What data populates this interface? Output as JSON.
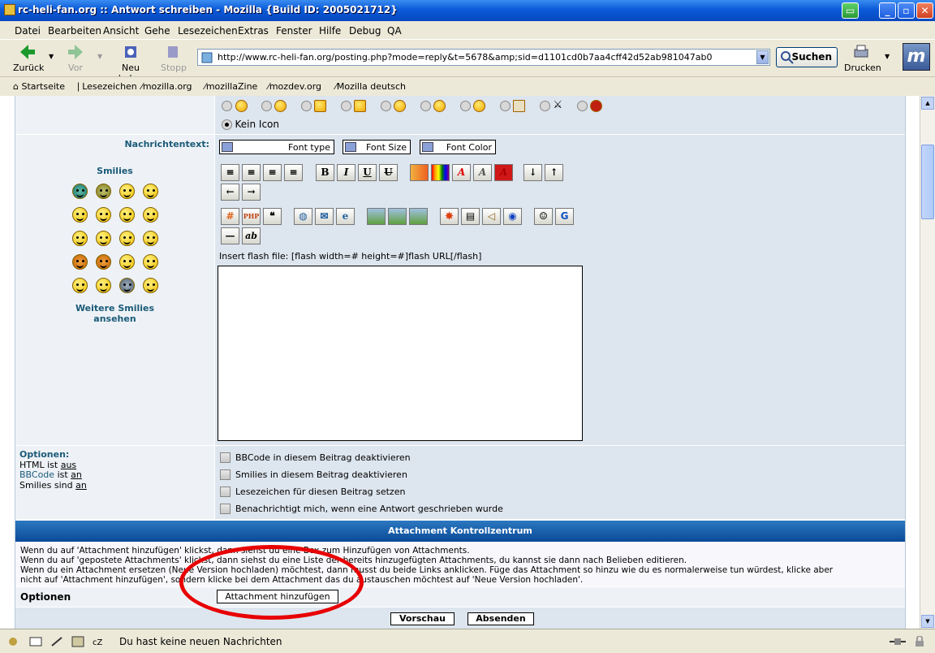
{
  "window": {
    "title": "rc-heli-fan.org :: Antwort schreiben - Mozilla {Build ID: 2005021712}"
  },
  "menu": [
    "Datei",
    "Bearbeiten",
    "Ansicht",
    "Gehe",
    "Lesezeichen",
    "Extras",
    "Fenster",
    "Hilfe",
    "Debug",
    "QA"
  ],
  "nav": {
    "back": "Zurück",
    "forward": "Vor",
    "reload": "Neu laden",
    "stop": "Stopp",
    "url": "http://www.rc-heli-fan.org/posting.php?mode=reply&t=5678&amp;sid=d1101cd0b7aa4cff42d52ab981047ab0",
    "search": "Suchen",
    "print": "Drucken"
  },
  "bookmarks": [
    "Startseite",
    "Lesezeichen",
    "mozilla.org",
    "mozillaZine",
    "mozdev.org",
    "Mozilla deutsch"
  ],
  "form": {
    "no_icon_label": "Kein Icon",
    "message_label": "Nachrichtentext:",
    "font_type": "Font type",
    "font_size": "Font Size",
    "font_color": "Font Color",
    "smilies_label": "Smilies",
    "more_smilies": "Weitere Smilies ansehen",
    "flash_hint": "Insert flash file: [flash width=# height=#]flash URL[/flash]",
    "options_title": "Optionen:",
    "html_status_prefix": "HTML ist",
    "html_status": "aus",
    "bbcode_prefix": "BBCode",
    "bbcode_mid": "ist",
    "bbcode_status": "an",
    "smilies_prefix": "Smilies sind",
    "smilies_status": "an",
    "checkboxes": [
      "BBCode in diesem Beitrag deaktivieren",
      "Smilies in diesem Beitrag deaktivieren",
      "Lesezeichen für diesen Beitrag setzen",
      "Benachrichtigt mich, wenn eine Antwort geschrieben wurde"
    ]
  },
  "attachments": {
    "header": "Attachment Kontrollzentrum",
    "line1": "Wenn du auf 'Attachment hinzufügen' klickst, dann siehst du eine Box zum Hinzufügen von Attachments.",
    "line2": "Wenn du auf 'gepostete Attachments' klickst, dann siehst du eine Liste der bereits hinzugefügten Attachments, du kannst sie dann nach Belieben editieren.",
    "line3": "Wenn du ein Attachment ersetzen (Neue Version hochladen) möchtest, dann musst du beide Links anklicken. Füge das Attachment so hinzu wie du es normalerweise tun würdest, klicke aber",
    "line4": "nicht auf 'Attachment hinzufügen', sondern klicke bei dem Attachment das du austauschen möchtest auf 'Neue Version hochladen'.",
    "options_label": "Optionen",
    "add_button": "Attachment hinzufügen"
  },
  "actions": {
    "preview": "Vorschau",
    "submit": "Absenden"
  },
  "status": {
    "message": "Du hast keine neuen Nachrichten"
  }
}
